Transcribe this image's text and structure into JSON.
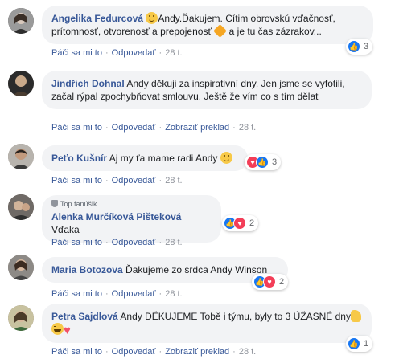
{
  "comments": [
    {
      "author": "Angelika Fedurcová",
      "text_parts": [
        "Andy.Ďakujem. Cítim obrovskú vďačnosť, prítomnosť, otvorenosť a prepojenosť",
        "a je tu čas zázrakov..."
      ],
      "reactions": {
        "types": [
          "like"
        ],
        "count": "3"
      },
      "actions": [
        "Páči sa mi to",
        "Odpovedať"
      ],
      "time": "28 t."
    },
    {
      "author": "Jindřich Dohnal",
      "text": "Andy děkuji za inspirativní dny. Jen jsme se vyfotili, začal rýpal zpochybňovat smlouvu. Ještě že vím co s tím dělat",
      "actions": [
        "Páči sa mi to",
        "Odpovedať",
        "Zobraziť preklad"
      ],
      "time": "28 t."
    },
    {
      "author": "Peťo Kušnír",
      "text": "Aj my ťa mame radi Andy",
      "reactions": {
        "types": [
          "love",
          "like"
        ],
        "count": "3"
      },
      "actions": [
        "Páči sa mi to",
        "Odpovedať"
      ],
      "time": "28 t."
    },
    {
      "badge": "Top fanúšik",
      "author": "Alenka Murčíková Pišteková",
      "text": "Vďaka",
      "reactions": {
        "types": [
          "like",
          "love"
        ],
        "count": "2"
      },
      "actions": [
        "Páči sa mi to",
        "Odpovedať"
      ],
      "time": "28 t."
    },
    {
      "author": "Maria Botozova",
      "text": "Ďakujeme zo srdca Andy Winson",
      "reactions": {
        "types": [
          "like",
          "love"
        ],
        "count": "2"
      },
      "actions": [
        "Páči sa mi to",
        "Odpovedať"
      ],
      "time": "28 t."
    },
    {
      "author": "Petra Sajdlová",
      "text_parts": [
        "Andy DĚKUJEME Tobě i týmu, byly to 3 ÚŽASNÉ",
        "dny"
      ],
      "reactions": {
        "types": [
          "like"
        ],
        "count": "1"
      },
      "actions": [
        "Páči sa mi to",
        "Odpovedať",
        "Zobraziť preklad"
      ],
      "time": "28 t."
    }
  ],
  "colors": {
    "author": "#385898",
    "bubble": "#f2f3f5",
    "like": "#1877f2",
    "love": "#f33e58"
  }
}
